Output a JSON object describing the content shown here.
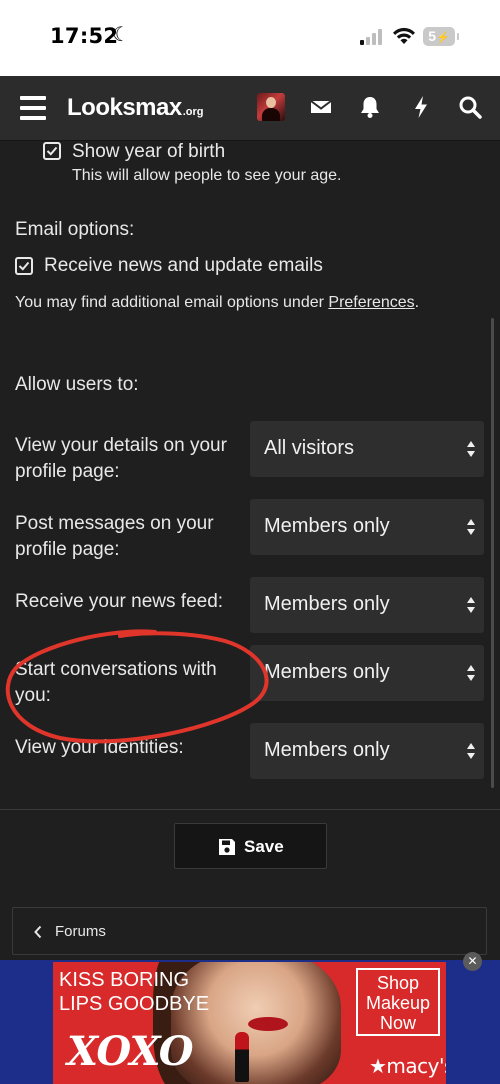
{
  "status_bar": {
    "time": "17:52",
    "battery": "5"
  },
  "header": {
    "logo_main": "Looksmax",
    "logo_tld": ".org",
    "icons": [
      "menu-icon",
      "avatar",
      "mail-icon",
      "bell-icon",
      "lightning-icon",
      "search-icon"
    ]
  },
  "privacy": {
    "show_year_label": "Show year of birth",
    "show_year_checked": true,
    "show_year_hint": "This will allow people to see your age."
  },
  "email": {
    "heading": "Email options:",
    "receive_news_label": "Receive news and update emails",
    "receive_news_checked": true,
    "note_prefix": "You may find additional email options under ",
    "note_link": "Preferences",
    "note_suffix": "."
  },
  "allow": {
    "heading": "Allow users to:",
    "fields": [
      {
        "label": "View your details on your profile page:",
        "value": "All visitors"
      },
      {
        "label": "Post messages on your profile page:",
        "value": "Members only"
      },
      {
        "label": "Receive your news feed:",
        "value": "Members only"
      },
      {
        "label": "Start conversations with you:",
        "value": "Members only"
      },
      {
        "label": "View your identities:",
        "value": "Members only"
      }
    ]
  },
  "actions": {
    "save_label": "Save"
  },
  "breadcrumb": {
    "label": "Forums"
  },
  "ad": {
    "headline_line1": "KISS BORING",
    "headline_line2": "LIPS GOODBYE",
    "brand": "XOXO",
    "cta_line1": "Shop",
    "cta_line2": "Makeup",
    "cta_line3": "Now",
    "store": "★macy's",
    "close": "✕"
  },
  "colors": {
    "background": "#1f1f1f",
    "header": "#2c2c2c",
    "select_bg": "#2e2e2e",
    "annotation": "#e0352b",
    "ad_blue": "#1d2e8a",
    "ad_red": "#d82a2a"
  }
}
